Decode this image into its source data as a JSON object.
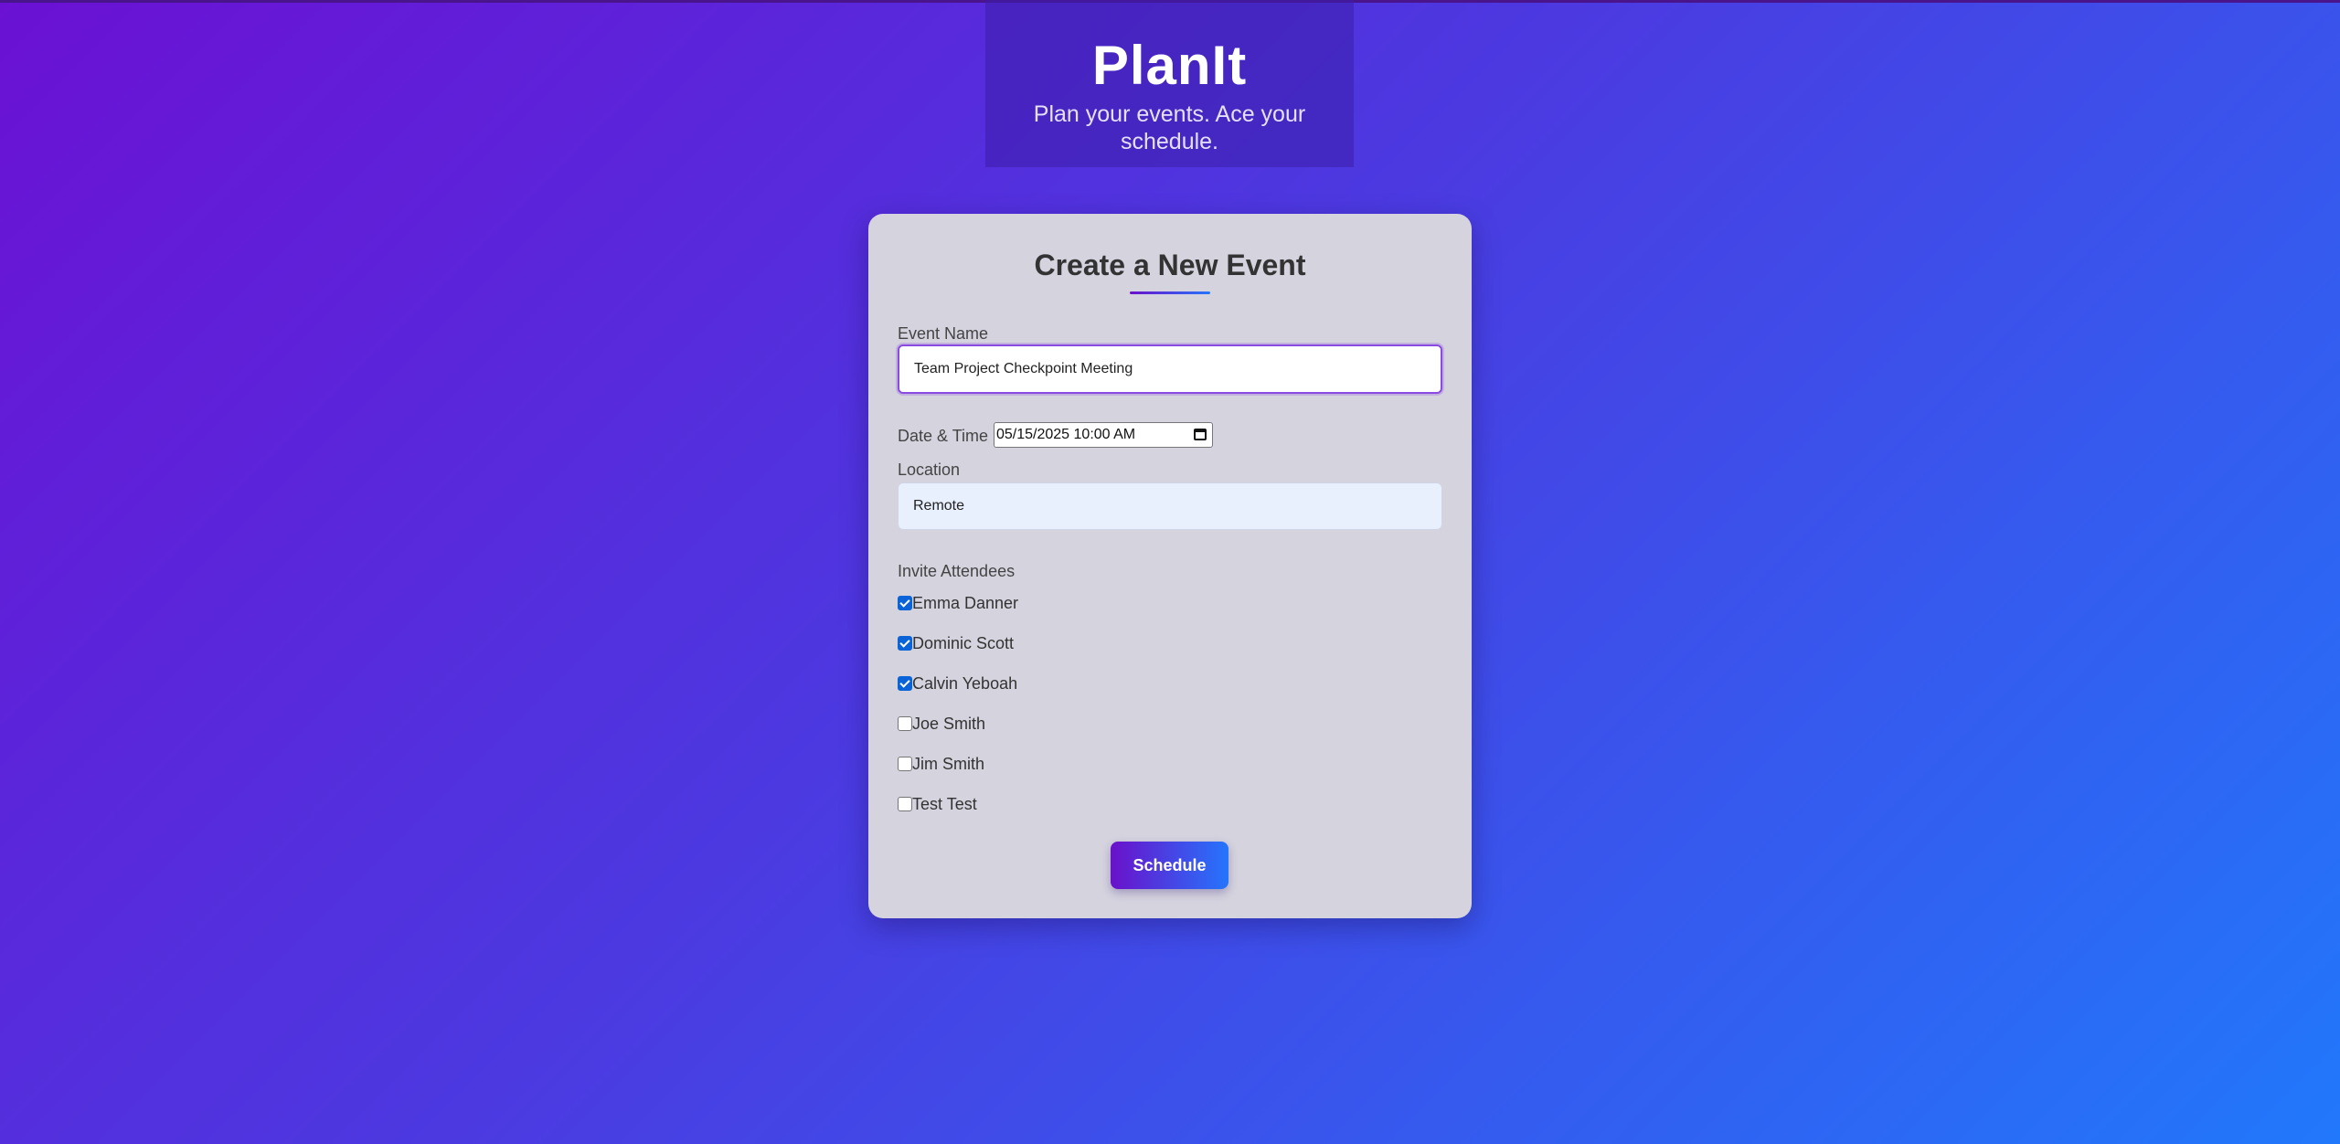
{
  "header": {
    "title": "PlanIt",
    "tagline": "Plan your events. Ace your schedule."
  },
  "form": {
    "heading": "Create a New Event",
    "event_name": {
      "label": "Event Name",
      "value": "Team Project Checkpoint Meeting"
    },
    "date_time": {
      "label": "Date & Time",
      "value": "05/15/2025 10:00  AM",
      "icon": "calendar-icon"
    },
    "location": {
      "label": "Location",
      "value": "Remote"
    },
    "attendees": {
      "label": "Invite Attendees",
      "items": [
        {
          "name": "Emma Danner",
          "checked": true
        },
        {
          "name": "Dominic Scott",
          "checked": true
        },
        {
          "name": "Calvin Yeboah",
          "checked": true
        },
        {
          "name": "Joe Smith",
          "checked": false
        },
        {
          "name": "Jim Smith",
          "checked": false
        },
        {
          "name": "Test Test",
          "checked": false
        }
      ]
    },
    "submit_label": "Schedule"
  },
  "colors": {
    "gradient_start": "#6a11cb",
    "gradient_end": "#2575fc",
    "card_background": "#d5d3de",
    "checkbox_checked": "#0b63d8"
  }
}
